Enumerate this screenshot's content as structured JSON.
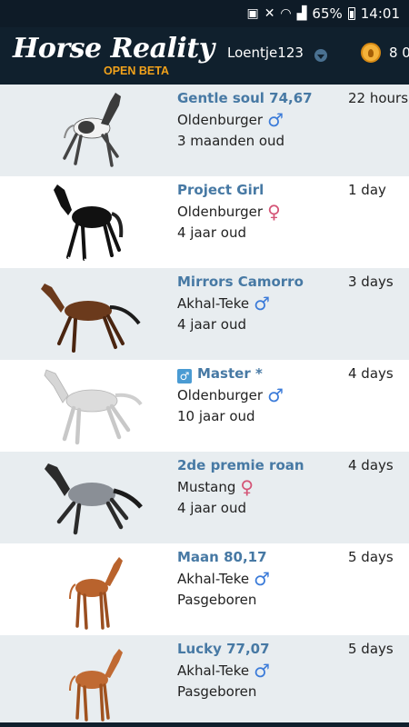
{
  "status_bar": {
    "battery": "65%",
    "time": "14:01"
  },
  "header": {
    "logo_title": "Horse Reality",
    "logo_subtitle": "OPEN BETA",
    "username": "Loentje123",
    "coins": "8 0"
  },
  "colors": {
    "header_bg": "#10202d",
    "link_blue": "#4779a4",
    "male": "#3b7bd9",
    "female": "#d45476",
    "row_shade": "#e8edf0"
  },
  "horses": [
    {
      "name": "Gentle soul 74,67",
      "breed": "Oldenburger",
      "gender": "♂",
      "age": "3 maanden oud",
      "time": "22 hours",
      "coat": "piebald-foal"
    },
    {
      "name": "Project Girl",
      "breed": "Oldenburger",
      "gender": "♀",
      "age": "4 jaar oud",
      "time": "1 day",
      "coat": "black"
    },
    {
      "name": "Mirrors Camorro",
      "breed": "Akhal-Teke",
      "gender": "♂",
      "age": "4 jaar oud",
      "time": "3 days",
      "coat": "bay"
    },
    {
      "name": "Master *",
      "breed": "Oldenburger",
      "gender": "♂",
      "age": "10 jaar oud",
      "time": "4 days",
      "coat": "grey",
      "badge": "♂"
    },
    {
      "name": "2de premie roan",
      "breed": "Mustang",
      "gender": "♀",
      "age": "4 jaar oud",
      "time": "4 days",
      "coat": "roan"
    },
    {
      "name": "Maan 80,17",
      "breed": "Akhal-Teke",
      "gender": "♂",
      "age": "Pasgeboren",
      "time": "5 days",
      "coat": "chestnut-foal"
    },
    {
      "name": "Lucky 77,07",
      "breed": "Akhal-Teke",
      "gender": "♂",
      "age": "Pasgeboren",
      "time": "5 days",
      "coat": "chestnut-foal"
    }
  ]
}
